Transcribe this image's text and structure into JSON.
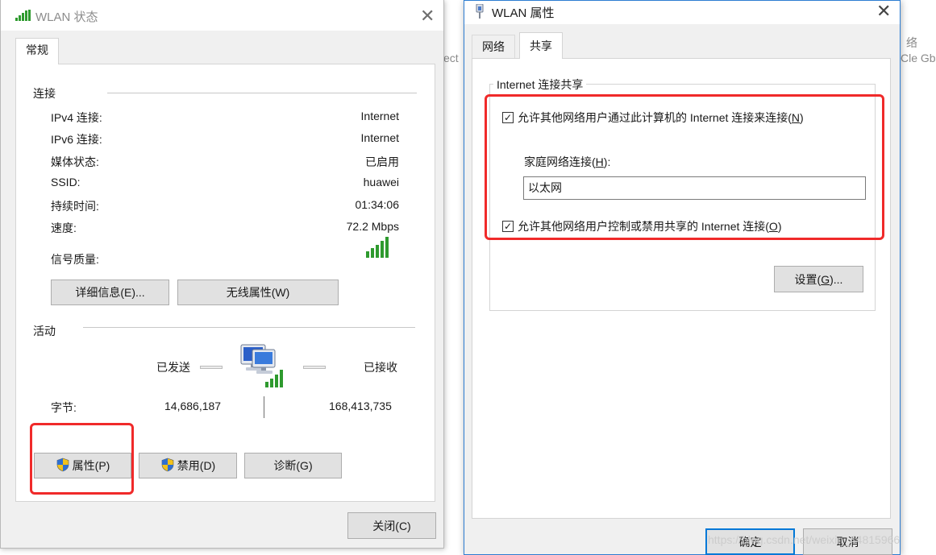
{
  "background": {
    "fragments": [
      "ect",
      "络",
      "Cle Gb"
    ]
  },
  "status_dialog": {
    "title": "WLAN 状态",
    "tab": "常规",
    "connection": {
      "heading": "连接",
      "rows": [
        {
          "label": "IPv4 连接:",
          "value": "Internet"
        },
        {
          "label": "IPv6 连接:",
          "value": "Internet"
        },
        {
          "label": "媒体状态:",
          "value": "已启用"
        },
        {
          "label": "SSID:",
          "value": "huawei"
        },
        {
          "label": "持续时间:",
          "value": "01:34:06"
        },
        {
          "label": "速度:",
          "value": "72.2 Mbps"
        }
      ],
      "signal_label": "信号质量:",
      "signal_bars": 5,
      "details_button": "详细信息(E)...",
      "wireless_button": "无线属性(W)"
    },
    "activity": {
      "heading": "活动",
      "sent_label": "已发送",
      "received_label": "已接收",
      "bytes_label": "字节:",
      "bytes_sent": "14,686,187",
      "bytes_received": "168,413,735"
    },
    "buttons": {
      "properties": "属性(P)",
      "disable": "禁用(D)",
      "diagnose": "诊断(G)",
      "close": "关闭(C)"
    }
  },
  "properties_dialog": {
    "title": "WLAN 属性",
    "tabs": [
      "网络",
      "共享"
    ],
    "active_tab": "共享",
    "group_title": "Internet 连接共享",
    "allow_connect": {
      "text_prefix": "允许其他网络用户通过此计算机的 Internet 连接来连接(",
      "accel": "N",
      "text_suffix": ")",
      "checked": true
    },
    "home_network": {
      "label_prefix": "家庭网络连接(",
      "accel": "H",
      "label_suffix": "):",
      "value": "以太网"
    },
    "allow_control": {
      "text_prefix": "允许其他网络用户控制或禁用共享的 Internet 连接(",
      "accel": "O",
      "text_suffix": ")",
      "checked": true
    },
    "settings_button": {
      "prefix": "设置(",
      "accel": "G",
      "suffix": ")..."
    },
    "ok_button": "确定",
    "cancel_button": "取消",
    "watermark": "https://blog.csdn.net/weixin_44815966"
  },
  "colors": {
    "highlight": "#f02a2a",
    "signal_green": "#2e9a2e",
    "focus_blue": "#0078d7",
    "shield_blue": "#2f6fd0",
    "shield_yellow": "#f2c21b"
  }
}
